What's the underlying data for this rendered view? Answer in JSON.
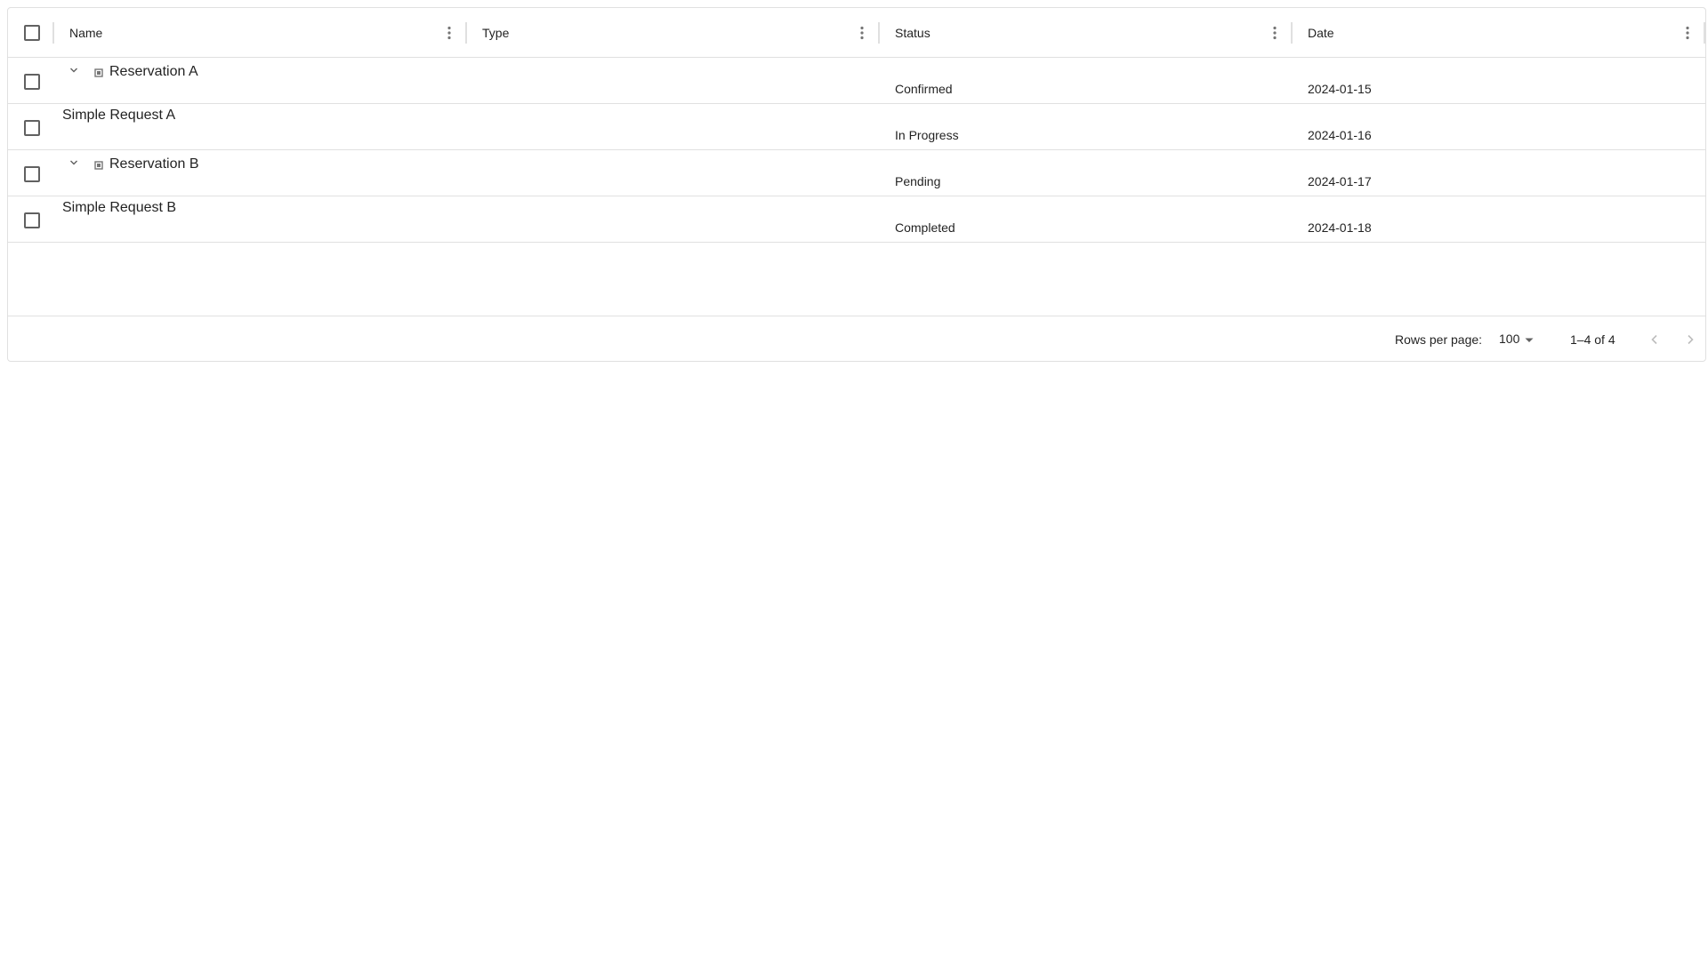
{
  "grid": {
    "columns": [
      {
        "title": "Name"
      },
      {
        "title": "Type"
      },
      {
        "title": "Status"
      },
      {
        "title": "Date"
      }
    ],
    "rows": [
      {
        "name": "Reservation A",
        "type": "",
        "status": "Confirmed",
        "date": "2024-01-15",
        "is_group": true,
        "expanded": true
      },
      {
        "name": "Simple Request A",
        "type": "",
        "status": "In Progress",
        "date": "2024-01-16",
        "is_group": false
      },
      {
        "name": "Reservation B",
        "type": "",
        "status": "Pending",
        "date": "2024-01-17",
        "is_group": true,
        "expanded": true
      },
      {
        "name": "Simple Request B",
        "type": "",
        "status": "Completed",
        "date": "2024-01-18",
        "is_group": false
      }
    ]
  },
  "footer": {
    "rows_per_page_label": "Rows per page:",
    "rows_per_page_value": "100",
    "page_range": "1–4 of 4"
  },
  "icons": {
    "expand": "chevron-down-icon",
    "group": "square-icon",
    "column_menu": "more-vert-icon",
    "select": "arrow-drop-down-icon",
    "prev": "chevron-left-icon",
    "next": "chevron-right-icon"
  },
  "colors": {
    "border": "#e0e0e0",
    "text": "#212121",
    "icon": "#757575",
    "disabled": "#bdbdbd"
  }
}
